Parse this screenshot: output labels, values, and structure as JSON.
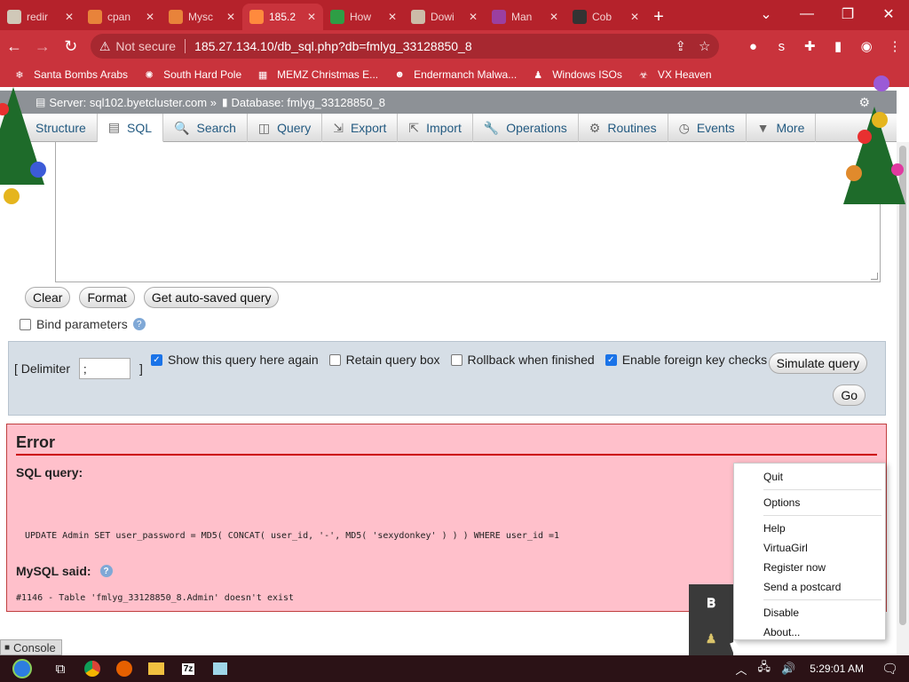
{
  "browser": {
    "tabs": [
      {
        "title": "redir",
        "color": "#d0c8b8"
      },
      {
        "title": "cpan",
        "color": "#e8833a"
      },
      {
        "title": "Mysc",
        "color": "#e8833a"
      },
      {
        "title": "185.2",
        "color": "#ff8a3d",
        "active": true
      },
      {
        "title": "How",
        "color": "#2e9e45"
      },
      {
        "title": "Dowi",
        "color": "#ccbca8"
      },
      {
        "title": "Man",
        "color": "#9b3fa0"
      },
      {
        "title": "Cob",
        "color": "#333333"
      }
    ],
    "new_tab": "+",
    "not_secure": "Not secure",
    "url": "185.27.134.10/db_sql.php?db=fmlyg_33128850_8",
    "bookmarks": [
      {
        "label": "Santa Bombs Arabs",
        "icon": "snowflake-icon"
      },
      {
        "label": "South Hard Pole",
        "icon": "spark-icon"
      },
      {
        "label": "MEMZ Christmas E...",
        "icon": "image-icon"
      },
      {
        "label": "Endermanch Malwa...",
        "icon": "raccoon-icon"
      },
      {
        "label": "Windows ISOs",
        "icon": "person-icon"
      },
      {
        "label": "VX Heaven",
        "icon": "biohazard-icon"
      }
    ]
  },
  "pma": {
    "server": "Server: sql102.byetcluster.com »",
    "database": "Database: fmlyg_33128850_8",
    "tabs": [
      {
        "label": "Structure",
        "icon": "structure-icon"
      },
      {
        "label": "SQL",
        "icon": "sql-icon",
        "active": true
      },
      {
        "label": "Search",
        "icon": "search-icon"
      },
      {
        "label": "Query",
        "icon": "query-icon"
      },
      {
        "label": "Export",
        "icon": "export-icon"
      },
      {
        "label": "Import",
        "icon": "import-icon"
      },
      {
        "label": "Operations",
        "icon": "wrench-icon"
      },
      {
        "label": "Routines",
        "icon": "routines-icon"
      },
      {
        "label": "Events",
        "icon": "clock-icon"
      },
      {
        "label": "More",
        "icon": "triangle-down-icon"
      }
    ],
    "buttons": {
      "clear": "Clear",
      "format": "Format",
      "autosaved": "Get auto-saved query"
    },
    "bind_params": "Bind parameters",
    "delimiter_label": "[ Delimiter",
    "delimiter_value": ";",
    "delimiter_close": "]",
    "options": [
      {
        "label": "Show this query here again",
        "checked": true
      },
      {
        "label": "Retain query box",
        "checked": false
      },
      {
        "label": "Rollback when finished",
        "checked": false
      },
      {
        "label": "Enable foreign key checks",
        "checked": true
      }
    ],
    "simulate": "Simulate query",
    "go": "Go",
    "error": {
      "title": "Error",
      "sql_query_label": "SQL query:",
      "sql": "UPDATE Admin SET user_password = MD5( CONCAT( user_id, '-', MD5( 'sexydonkey' ) ) ) WHERE user_id =1",
      "mysql_said": "MySQL said:",
      "message": "#1146 - Table 'fmlyg_33128850_8.Admin' doesn't exist"
    },
    "console": "Console"
  },
  "context_menu": {
    "groups": [
      [
        "Quit"
      ],
      [
        "Options"
      ],
      [
        "Help",
        "VirtuaGirl",
        "Register now",
        "Send a postcard"
      ],
      [
        "Disable",
        "About..."
      ]
    ]
  },
  "taskbar": {
    "clock": "5:29:01 AM"
  },
  "colors": {
    "chrome_frame": "#b5222b",
    "error_bg": "#ffc0cb"
  }
}
